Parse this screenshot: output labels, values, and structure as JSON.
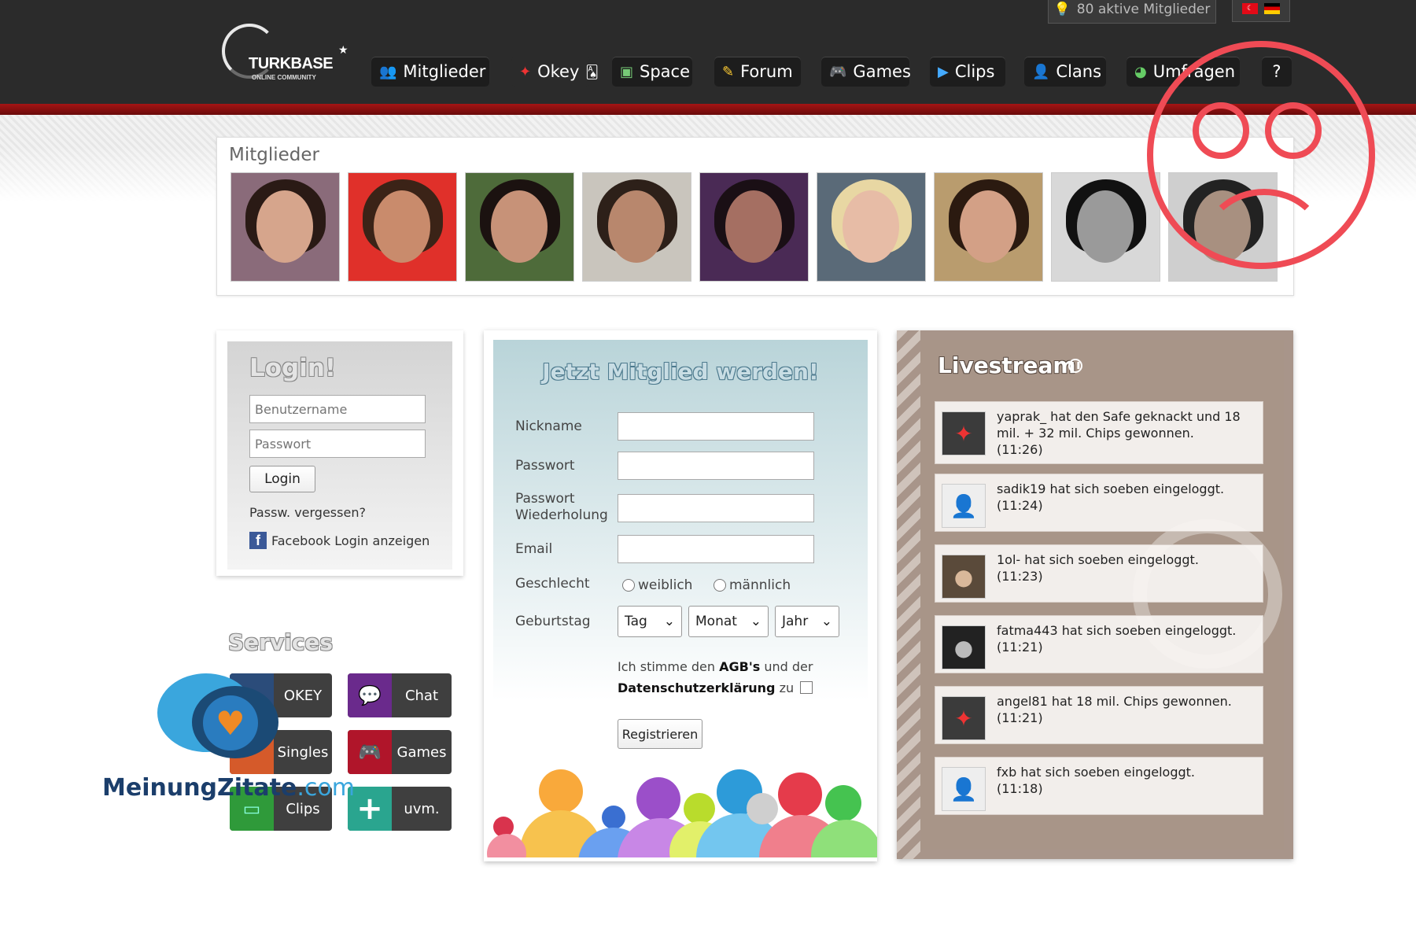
{
  "header": {
    "logo_text": "TURKBASE",
    "logo_sub": "ONLINE COMMUNITY",
    "online_count": "80 aktive Mitglieder",
    "nav": [
      {
        "label": "Mitglieder",
        "icon": "people-icon"
      },
      {
        "label": "Okey",
        "icon": "cards-icon"
      },
      {
        "label": "Space",
        "icon": "space-icon"
      },
      {
        "label": "Forum",
        "icon": "pen-icon"
      },
      {
        "label": "Games",
        "icon": "gamepad-icon"
      },
      {
        "label": "Clips",
        "icon": "play-icon"
      },
      {
        "label": "Clans",
        "icon": "clan-icon"
      },
      {
        "label": "Umfragen",
        "icon": "pie-chart-icon"
      }
    ],
    "help": "?"
  },
  "members": {
    "title": "Mitglieder"
  },
  "login": {
    "title": "Login!",
    "username_placeholder": "Benutzername",
    "password_placeholder": "Passwort",
    "login_button": "Login",
    "forgot": "Passw. vergessen?",
    "facebook": "Facebook Login anzeigen"
  },
  "services": {
    "title": "Services",
    "items": [
      "OKEY",
      "Chat",
      "Singles",
      "Games",
      "Clips",
      "uvm."
    ]
  },
  "register": {
    "title": "Jetzt Mitglied werden!",
    "nickname": "Nickname",
    "password": "Passwort",
    "password_repeat_1": "Passwort",
    "password_repeat_2": "Wiederholung",
    "email": "Email",
    "gender": "Geschlecht",
    "female": "weiblich",
    "male": "männlich",
    "birthday": "Geburtstag",
    "day": "Tag",
    "month": "Monat",
    "year": "Jahr",
    "agb_1": "Ich stimme den ",
    "agb_bold": "AGB's",
    "agb_2": " und der",
    "privacy_bold": "Datenschutzerklärung",
    "agb_3": " zu",
    "register_button": "Registrieren"
  },
  "livestream": {
    "title": "Livestream",
    "entries": [
      {
        "text": "yaprak_ hat den Safe geknackt und 18 mil. + 32 mil. Chips gewonnen.",
        "time": "(11:26)"
      },
      {
        "text": "sadik19 hat sich soeben eingeloggt.",
        "time": "(11:24)"
      },
      {
        "text": "1ol- hat sich soeben eingeloggt.",
        "time": "(11:23)"
      },
      {
        "text": "fatma443 hat sich soeben eingeloggt.",
        "time": "(11:21)"
      },
      {
        "text": "angel81 hat 18 mil. Chips gewonnen.",
        "time": "(11:21)"
      },
      {
        "text": "fxb hat sich soeben eingeloggt.",
        "time": "(11:18)"
      }
    ]
  },
  "watermark": {
    "brand": "MeinungZitate",
    "tld": ".com"
  }
}
